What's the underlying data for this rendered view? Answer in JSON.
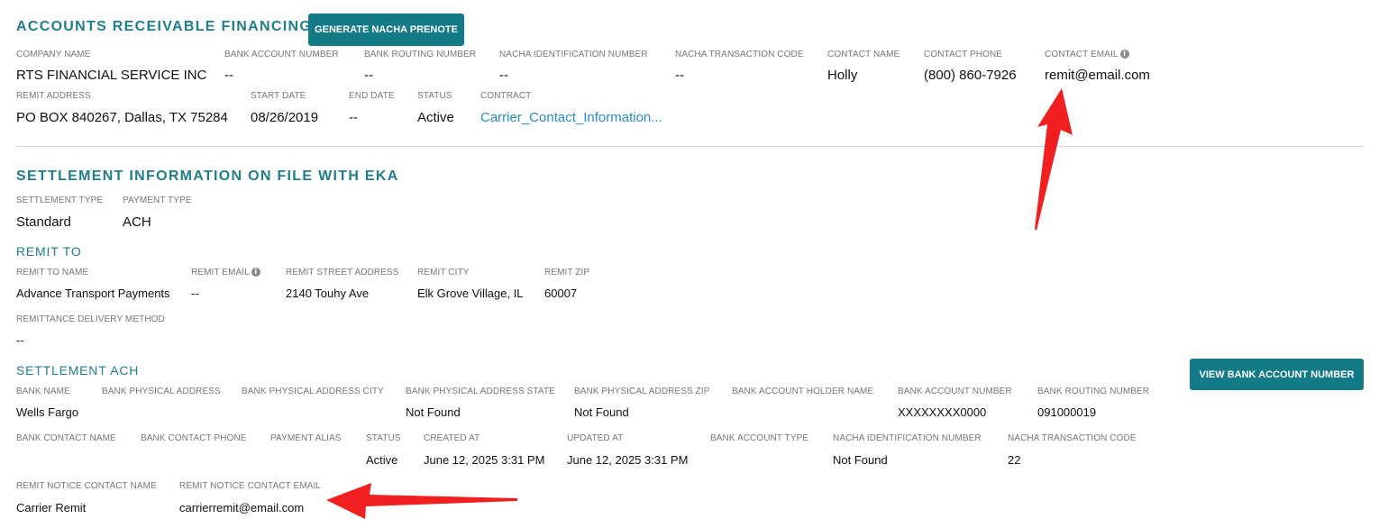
{
  "arf": {
    "title": "ACCOUNTS RECEIVABLE FINANCING",
    "prenote_button": "GENERATE NACHA PRENOTE",
    "labels": {
      "company_name": "COMPANY NAME",
      "bank_account_number": "BANK ACCOUNT NUMBER",
      "bank_routing_number": "BANK ROUTING NUMBER",
      "nacha_id": "NACHA IDENTIFICATION NUMBER",
      "nacha_code": "NACHA TRANSACTION CODE",
      "contact_name": "CONTACT NAME",
      "contact_phone": "CONTACT PHONE",
      "contact_email": "CONTACT EMAIL",
      "remit_address": "REMIT ADDRESS",
      "start_date": "START DATE",
      "end_date": "END DATE",
      "status": "STATUS",
      "contract": "CONTRACT"
    },
    "values": {
      "company_name": "RTS FINANCIAL SERVICE INC",
      "bank_account_number": "--",
      "bank_routing_number": "--",
      "nacha_id": "--",
      "nacha_code": "--",
      "contact_name": "Holly",
      "contact_phone": "(800) 860-7926",
      "contact_email": "remit@email.com",
      "remit_address": "PO BOX 840267, Dallas, TX 75284",
      "start_date": "08/26/2019",
      "end_date": "--",
      "status": "Active",
      "contract": "Carrier_Contact_Information..."
    }
  },
  "settlement": {
    "title": "SETTLEMENT INFORMATION ON FILE WITH EKA",
    "labels": {
      "settlement_type": "SETTLEMENT TYPE",
      "payment_type": "PAYMENT TYPE"
    },
    "values": {
      "settlement_type": "Standard",
      "payment_type": "ACH"
    }
  },
  "remit_to": {
    "title": "REMIT TO",
    "labels": {
      "name": "REMIT TO NAME",
      "email": "REMIT EMAIL",
      "street": "REMIT STREET ADDRESS",
      "city": "REMIT CITY",
      "zip": "REMIT ZIP",
      "delivery": "REMITTANCE DELIVERY METHOD"
    },
    "values": {
      "name": "Advance Transport Payments",
      "email": "--",
      "street": "2140 Touhy Ave",
      "city": "Elk Grove Village, IL",
      "zip": "60007",
      "delivery": "--"
    }
  },
  "settlement_ach": {
    "title": "SETTLEMENT ACH",
    "view_button": "VIEW BANK ACCOUNT NUMBER",
    "labels": {
      "bank_name": "BANK NAME",
      "bank_physical_address": "BANK PHYSICAL ADDRESS",
      "bank_physical_city": "BANK PHYSICAL ADDRESS CITY",
      "bank_physical_state": "BANK PHYSICAL ADDRESS STATE",
      "bank_physical_zip": "BANK PHYSICAL ADDRESS ZIP",
      "account_holder": "BANK ACCOUNT HOLDER NAME",
      "account_number": "BANK ACCOUNT NUMBER",
      "routing_number": "BANK ROUTING NUMBER",
      "contact_name": "BANK CONTACT NAME",
      "contact_phone": "BANK CONTACT PHONE",
      "payment_alias": "PAYMENT ALIAS",
      "status": "STATUS",
      "created_at": "CREATED AT",
      "updated_at": "UPDATED AT",
      "account_type": "BANK ACCOUNT TYPE",
      "nacha_id": "NACHA IDENTIFICATION NUMBER",
      "nacha_code": "NACHA TRANSACTION CODE",
      "notice_contact_name": "REMIT NOTICE CONTACT NAME",
      "notice_contact_email": "REMIT NOTICE CONTACT EMAIL"
    },
    "values": {
      "bank_name": "Wells Fargo",
      "bank_physical_state": "Not Found",
      "bank_physical_zip": "Not Found",
      "account_number": "XXXXXXXX0000",
      "routing_number": "091000019",
      "status": "Active",
      "created_at": "June 12, 2025 3:31 PM",
      "updated_at": "June 12, 2025 3:31 PM",
      "nacha_id": "Not Found",
      "nacha_code": "22",
      "notice_contact_name": "Carrier Remit",
      "notice_contact_email": "carrierremit@email.com"
    }
  },
  "icons": {
    "info": "info-icon",
    "arrow": "annotation-arrow-icon"
  },
  "colors": {
    "accent": "#1f7d8c",
    "button": "#137a88",
    "link": "#2a8bc9",
    "arrow": "#f02020"
  }
}
